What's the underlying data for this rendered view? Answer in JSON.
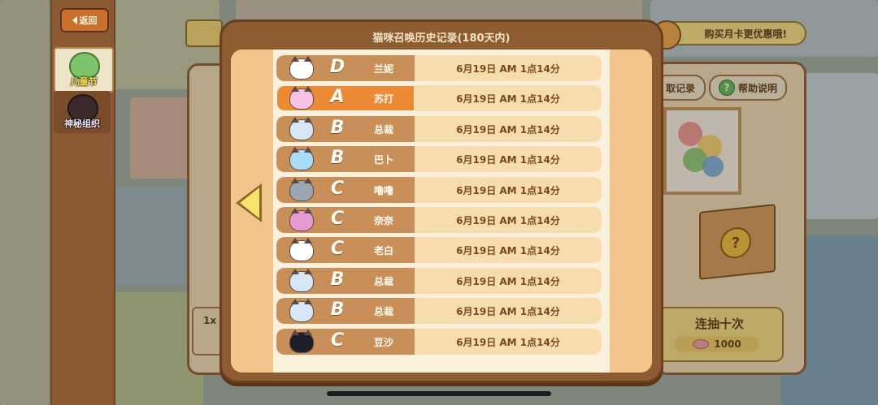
{
  "nav": {
    "back_label": "返回",
    "events": [
      {
        "label": "儿童节",
        "icon": "frog-cat-icon"
      },
      {
        "label": "神秘组织",
        "icon": "black-cat-icon"
      }
    ]
  },
  "background": {
    "promo_label": "购买月卡更优惠哦!",
    "record_label": "取记录",
    "help_label": "帮助说明",
    "draw_ten_label": "连抽十次",
    "draw_ten_cost": "1000",
    "left_card_text": "1x"
  },
  "modal": {
    "title": "猫咪召唤历史记录(180天内)",
    "records": [
      {
        "grade": "D",
        "name": "兰妮",
        "time": "6月19日 AM 1点14分",
        "color": "#ffffff",
        "highlighted": false
      },
      {
        "grade": "A",
        "name": "苏打",
        "time": "6月19日 AM 1点14分",
        "color": "#f6c3e4",
        "highlighted": true
      },
      {
        "grade": "B",
        "name": "总裁",
        "time": "6月19日 AM 1点14分",
        "color": "#d7e6f5",
        "highlighted": false
      },
      {
        "grade": "B",
        "name": "巴卜",
        "time": "6月19日 AM 1点14分",
        "color": "#a9dcf7",
        "highlighted": false
      },
      {
        "grade": "C",
        "name": "噜噜",
        "time": "6月19日 AM 1点14分",
        "color": "#9aa7b1",
        "highlighted": false
      },
      {
        "grade": "C",
        "name": "奈奈",
        "time": "6月19日 AM 1点14分",
        "color": "#e69bd4",
        "highlighted": false
      },
      {
        "grade": "C",
        "name": "老白",
        "time": "6月19日 AM 1点14分",
        "color": "#ffffff",
        "highlighted": false
      },
      {
        "grade": "B",
        "name": "总裁",
        "time": "6月19日 AM 1点14分",
        "color": "#d7e6f5",
        "highlighted": false
      },
      {
        "grade": "B",
        "name": "总裁",
        "time": "6月19日 AM 1点14分",
        "color": "#d7e6f5",
        "highlighted": false
      },
      {
        "grade": "C",
        "name": "豆沙",
        "time": "6月19日 AM 1点14分",
        "color": "#1e1e2a",
        "highlighted": false
      }
    ]
  }
}
